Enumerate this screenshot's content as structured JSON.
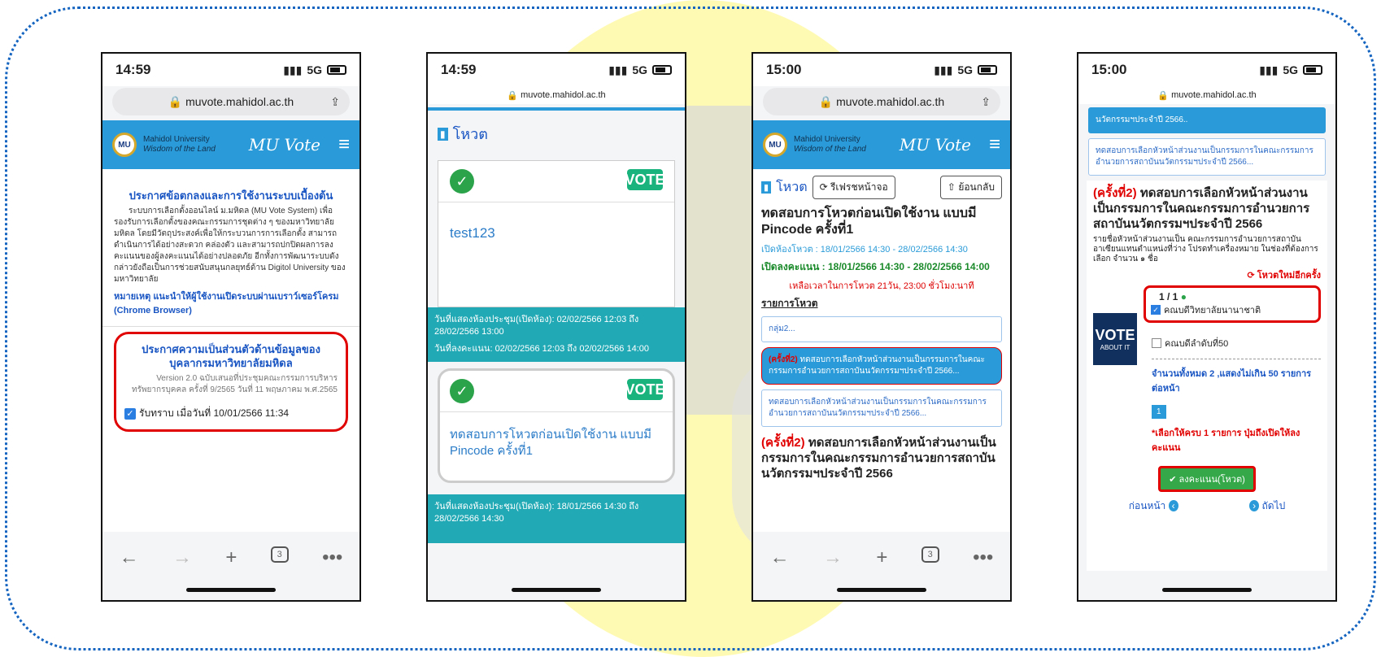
{
  "phones": [
    {
      "time": "14:59",
      "signal": "5G",
      "url": "muvote.mahidol.ac.th",
      "university": "Mahidol University",
      "tagline": "Wisdom of the Land",
      "app_name": "MU Vote",
      "announcement_title": "ประกาศข้อตกลงและการใช้งานระบบเบื้องต้น",
      "announcement_body": "ระบบการเลือกตั้งออนไลน์ ม.มหิดล (MU Vote System) เพื่อรองรับการเลือกตั้งของคณะกรรมการชุดต่าง ๆ ของมหาวิทยาลัยมหิดล โดยมีวัตถุประสงค์เพื่อให้กระบวนการการเลือกตั้ง สามารถดำเนินการได้อย่างสะดวก คล่องตัว และสามารถปกปิดผลการลงคะแนนของผู้ลงคะแนนได้อย่างปลอดภัย อีกทั้งการพัฒนาระบบดังกล่าวยังถือเป็นการช่วยสนับสนุนกลยุทธ์ด้าน Digitol University ของมหาวิทยาลัย",
      "note": "หมายเหตุ แนะนำให้ผู้ใช้งานเปิดระบบผ่านเบราว์เซอร์โครม (Chrome Browser)",
      "privacy_title": "ประกาศความเป็นส่วนตัวด้านข้อมูลของบุคลากรมหาวิทยาลัยมหิดล",
      "privacy_text": "Version 2.0 ฉบับเสนอที่ประชุมคณะกรรมการบริหารทรัพยากรบุคคล ครั้งที่ 9/2565 วันที่ 11 พฤษภาคม พ.ศ.2565",
      "ack": "รับทราบ เมื่อวันที่ 10/01/2566 11:34",
      "tab_count": "3"
    },
    {
      "time": "14:59",
      "signal": "5G",
      "url": "muvote.mahidol.ac.th",
      "section_title": "โหวต",
      "vote_badge": "VOTE",
      "item1_title": "test123",
      "item1_meeting": "วันที่แสดงห้องประชุม(เปิดห้อง): 02/02/2566 12:03 ถึง 28/02/2566 13:00",
      "item1_voting": "วันที่ลงคะแนน: 02/02/2566 12:03 ถึง 02/02/2566 14:00",
      "item2_title": "ทดสอบการโหวตก่อนเปิดใช้งาน แบบมี Pincode ครั้งที่1",
      "item2_meeting": "วันที่แสดงห้องประชุม(เปิดห้อง): 18/01/2566 14:30 ถึง 28/02/2566 14:30"
    },
    {
      "time": "15:00",
      "signal": "5G",
      "url": "muvote.mahidol.ac.th",
      "university": "Mahidol University",
      "tagline": "Wisdom of the Land",
      "app_name": "MU Vote",
      "section_title": "โหวต",
      "refresh": "รีเฟรชหน้าจอ",
      "back": "ย้อนกลับ",
      "vote_title": "ทดสอบการโหวตก่อนเปิดใช้งาน แบบมี Pincode ครั้งที่1",
      "room_open": "เปิดห้องโหวต : 18/01/2566 14:30 - 28/02/2566 14:30",
      "voting_open": "เปิดลงคะแนน : 18/01/2566 14:30 - 28/02/2566 14:00",
      "remaining": "เหลือเวลาในการโหวต 21วัน, 23:00 ชั่วโมง:นาที",
      "list_title": "รายการโหวต",
      "list_group": "กลุ่ม2...",
      "list_item_active_tag": "(ครั้งที่2)",
      "list_item_active": "ทดสอบการเลือกหัวหน้าส่วนงานเป็นกรรมการในคณะกรรมการอำนวยการสถาบันนวัตกรรมฯประจำปี 2566...",
      "list_item_2": "ทดสอบการเลือกหัวหน้าส่วนงานเป็นกรรมการในคณะกรรมการอำนวยการสถาบันนวัตกรรมฯประจำปี 2566...",
      "detail_tag": "(ครั้งที่2)",
      "detail_title": "ทดสอบการเลือกหัวหน้าส่วนงานเป็นกรรมการในคณะกรรมการอำนวยการสถาบันนวัตกรรมฯประจำปี 2566",
      "tab_count": "3"
    },
    {
      "time": "15:00",
      "signal": "5G",
      "url": "muvote.mahidol.ac.th",
      "top_item": "นวัตกรรมฯประจำปี 2566..",
      "list_item": "ทดสอบการเลือกหัวหน้าส่วนงานเป็นกรรมการในคณะกรรมการอำนวยการสถาบันนวัตกรรมฯประจำปี 2566...",
      "detail_tag": "(ครั้งที่2)",
      "detail_title": "ทดสอบการเลือกหัวหน้าส่วนงานเป็นกรรมการในคณะกรรมการอำนวยการสถาบันนวัตกรรมฯประจำปี 2566",
      "instructions": "รายชื่อหัวหน้าส่วนงานเป็น คณะกรรมการอำนวยการสถาบันอาเซียนแทนตำแหน่งที่ว่าง โปรดทำเครื่องหมาย ในช่องที่ต้องการเลือก จำนวน ๑ ชื่อ",
      "revote": "โหวตใหม่อีกครั้ง",
      "count": "1 / 1",
      "option1": "คณบดีวิทยาลัยนานาชาติ",
      "option2": "คณบดีลำดับที่50",
      "total": "จำนวนทั้งหมด 2 ,แสดงไม่เกิน 50 รายการต่อหน้า",
      "page": "1",
      "must_select": "*เลือกให้ครบ 1 รายการ ปุ่มถึงเปิดให้ลงคะแนน",
      "submit": "ลงคะแนน(โหวต)",
      "prev": "ก่อนหน้า",
      "next": "ถัดไป",
      "vote_logo_text": "VOTE",
      "vote_logo_sub": "ABOUT IT"
    }
  ]
}
